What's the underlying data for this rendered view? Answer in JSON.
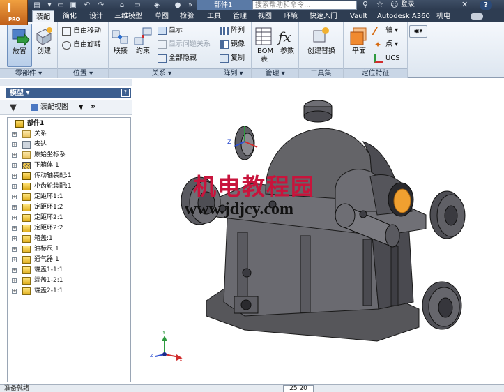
{
  "app": {
    "logo_badge": "PRO",
    "document_tab": "部件1",
    "search_placeholder": "搜索帮助和命令...",
    "login_label": "登录",
    "help_label": "?"
  },
  "ribbon_tabs": [
    {
      "label": "装配",
      "active": true
    },
    {
      "label": "简化"
    },
    {
      "label": "设计"
    },
    {
      "label": "三维模型"
    },
    {
      "label": "草图"
    },
    {
      "label": "检验"
    },
    {
      "label": "工具"
    },
    {
      "label": "管理"
    },
    {
      "label": "视图"
    },
    {
      "label": "环境"
    },
    {
      "label": "快速入门"
    },
    {
      "label": "Vault"
    },
    {
      "label": "Autodesk A360"
    },
    {
      "label": "机电"
    }
  ],
  "ribbon": {
    "components_panel": {
      "title": "零部件 ▾",
      "place": "放置",
      "create": "创建"
    },
    "position_panel": {
      "title": "位置 ▾",
      "free_move": "自由移动",
      "free_rotate": "自由旋转"
    },
    "relationships_panel": {
      "title": "关系 ▾",
      "joint": "联接",
      "constrain": "约束",
      "show": "显示",
      "show_sick": "显示问题关系",
      "hide_all": "全部隐藏"
    },
    "pattern_panel": {
      "title": "阵列 ▾",
      "pattern": "阵列",
      "mirror": "镜像",
      "copy": "复制"
    },
    "manage_panel": {
      "title": "管理 ▾",
      "bom": "BOM表",
      "parameters": "参数"
    },
    "productivity_panel": {
      "title": "工具集",
      "create_substitute": "创建替换"
    },
    "work_features_panel": {
      "title": "定位特征",
      "plane": "平面",
      "axis": "轴 ▾",
      "point": "点 ▾",
      "ucs": "UCS"
    }
  },
  "browser": {
    "title": "模型 ▾",
    "help": "?",
    "view_label": "装配视图",
    "tree": [
      {
        "label": "部件1",
        "icon": "assembly-icon",
        "level": 0,
        "bold": true
      },
      {
        "label": "关系",
        "icon": "folder-icon",
        "level": 1
      },
      {
        "label": "表达",
        "icon": "representation-icon",
        "level": 1
      },
      {
        "label": "原始坐标系",
        "icon": "folder-icon",
        "level": 1
      },
      {
        "label": "下箱体:1",
        "icon": "pattern-part-icon",
        "level": 1
      },
      {
        "label": "传动轴装配:1",
        "icon": "assembly-icon",
        "level": 1
      },
      {
        "label": "小齿轮装配:1",
        "icon": "assembly-icon",
        "level": 1
      },
      {
        "label": "定距环1:1",
        "icon": "part-icon",
        "level": 1
      },
      {
        "label": "定距环1:2",
        "icon": "part-icon",
        "level": 1
      },
      {
        "label": "定距环2:1",
        "icon": "part-icon",
        "level": 1
      },
      {
        "label": "定距环2:2",
        "icon": "part-icon",
        "level": 1
      },
      {
        "label": "箱盖:1",
        "icon": "part-icon",
        "level": 1
      },
      {
        "label": "油标尺:1",
        "icon": "part-icon",
        "level": 1
      },
      {
        "label": "通气器:1",
        "icon": "part-icon",
        "level": 1
      },
      {
        "label": "端盖1-1:1",
        "icon": "part-icon",
        "level": 1
      },
      {
        "label": "端盖1-2:1",
        "icon": "part-icon",
        "level": 1
      },
      {
        "label": "端盖2-1:1",
        "icon": "part-icon",
        "level": 1
      }
    ]
  },
  "viewport": {
    "watermark_cn": "机电教程园",
    "watermark_url": "www.jdjcy.com",
    "triad": {
      "x": "X",
      "y": "Y",
      "z": "Z"
    }
  },
  "status": {
    "text": "准备就绪",
    "count": "25 20"
  },
  "colors": {
    "title_bar": "#2c3a4f",
    "ribbon_bg": "#dde6f0",
    "browser_header": "#3d5f8f",
    "model_gray": "#5c5c60",
    "bearing_orange": "#f0a030",
    "watermark_red": "#c8143c"
  }
}
